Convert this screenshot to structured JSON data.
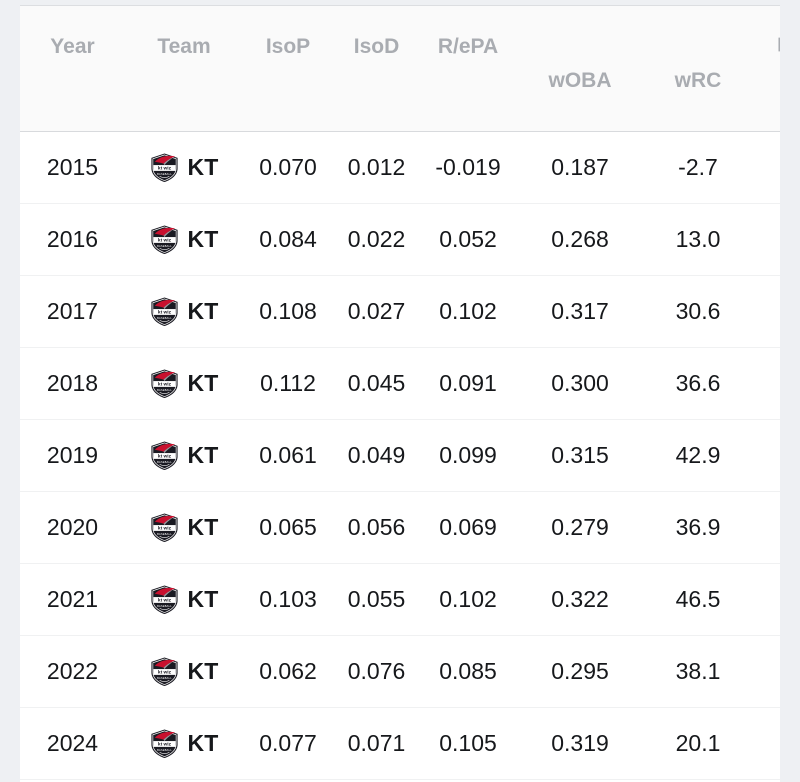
{
  "table": {
    "columns": [
      {
        "key": "year",
        "label": "Year",
        "baseline": "upper"
      },
      {
        "key": "team",
        "label": "Team",
        "baseline": "upper"
      },
      {
        "key": "isop",
        "label": "IsoP",
        "baseline": "upper"
      },
      {
        "key": "isod",
        "label": "IsoD",
        "baseline": "upper"
      },
      {
        "key": "repa",
        "label": "R/ePA",
        "baseline": "upper"
      },
      {
        "key": "woba",
        "label": "wOBA",
        "baseline": "lower"
      },
      {
        "key": "wrc",
        "label": "wRC",
        "baseline": "lower"
      }
    ],
    "overflow_label": "타",
    "team_logo_name": "kt-wiz-logo",
    "rows": [
      {
        "year": "2015",
        "team": "KT",
        "isop": "0.070",
        "isod": "0.012",
        "repa": "-0.019",
        "woba": "0.187",
        "wrc": "-2.7"
      },
      {
        "year": "2016",
        "team": "KT",
        "isop": "0.084",
        "isod": "0.022",
        "repa": "0.052",
        "woba": "0.268",
        "wrc": "13.0"
      },
      {
        "year": "2017",
        "team": "KT",
        "isop": "0.108",
        "isod": "0.027",
        "repa": "0.102",
        "woba": "0.317",
        "wrc": "30.6"
      },
      {
        "year": "2018",
        "team": "KT",
        "isop": "0.112",
        "isod": "0.045",
        "repa": "0.091",
        "woba": "0.300",
        "wrc": "36.6"
      },
      {
        "year": "2019",
        "team": "KT",
        "isop": "0.061",
        "isod": "0.049",
        "repa": "0.099",
        "woba": "0.315",
        "wrc": "42.9"
      },
      {
        "year": "2020",
        "team": "KT",
        "isop": "0.065",
        "isod": "0.056",
        "repa": "0.069",
        "woba": "0.279",
        "wrc": "36.9"
      },
      {
        "year": "2021",
        "team": "KT",
        "isop": "0.103",
        "isod": "0.055",
        "repa": "0.102",
        "woba": "0.322",
        "wrc": "46.5"
      },
      {
        "year": "2022",
        "team": "KT",
        "isop": "0.062",
        "isod": "0.076",
        "repa": "0.085",
        "woba": "0.295",
        "wrc": "38.1"
      },
      {
        "year": "2024",
        "team": "KT",
        "isop": "0.077",
        "isod": "0.071",
        "repa": "0.105",
        "woba": "0.319",
        "wrc": "20.1"
      }
    ]
  },
  "colors": {
    "page_background": "#eef0f3",
    "card_background": "#ffffff",
    "header_background": "#fafafa",
    "header_text": "#a9acb1",
    "body_text": "#16181b",
    "row_divider": "#f0f1f2",
    "header_divider": "#d8dadd",
    "logo_red": "#c8102e",
    "logo_dark": "#1a1a22"
  },
  "chart_data": {
    "type": "table",
    "title": "",
    "categories": [
      "2015",
      "2016",
      "2017",
      "2018",
      "2019",
      "2020",
      "2021",
      "2022",
      "2024"
    ],
    "xlabel": "Year",
    "ylabel": "",
    "series": [
      {
        "name": "IsoP",
        "values": [
          0.07,
          0.084,
          0.108,
          0.112,
          0.061,
          0.065,
          0.103,
          0.062,
          0.077
        ]
      },
      {
        "name": "IsoD",
        "values": [
          0.012,
          0.022,
          0.027,
          0.045,
          0.049,
          0.056,
          0.055,
          0.076,
          0.071
        ]
      },
      {
        "name": "R/ePA",
        "values": [
          -0.019,
          0.052,
          0.102,
          0.091,
          0.099,
          0.069,
          0.102,
          0.085,
          0.105
        ]
      },
      {
        "name": "wOBA",
        "values": [
          0.187,
          0.268,
          0.317,
          0.3,
          0.315,
          0.279,
          0.322,
          0.295,
          0.319
        ]
      },
      {
        "name": "wRC",
        "values": [
          -2.7,
          13.0,
          30.6,
          36.6,
          42.9,
          36.9,
          46.5,
          38.1,
          20.1
        ]
      }
    ],
    "grid": false,
    "legend": "none"
  }
}
